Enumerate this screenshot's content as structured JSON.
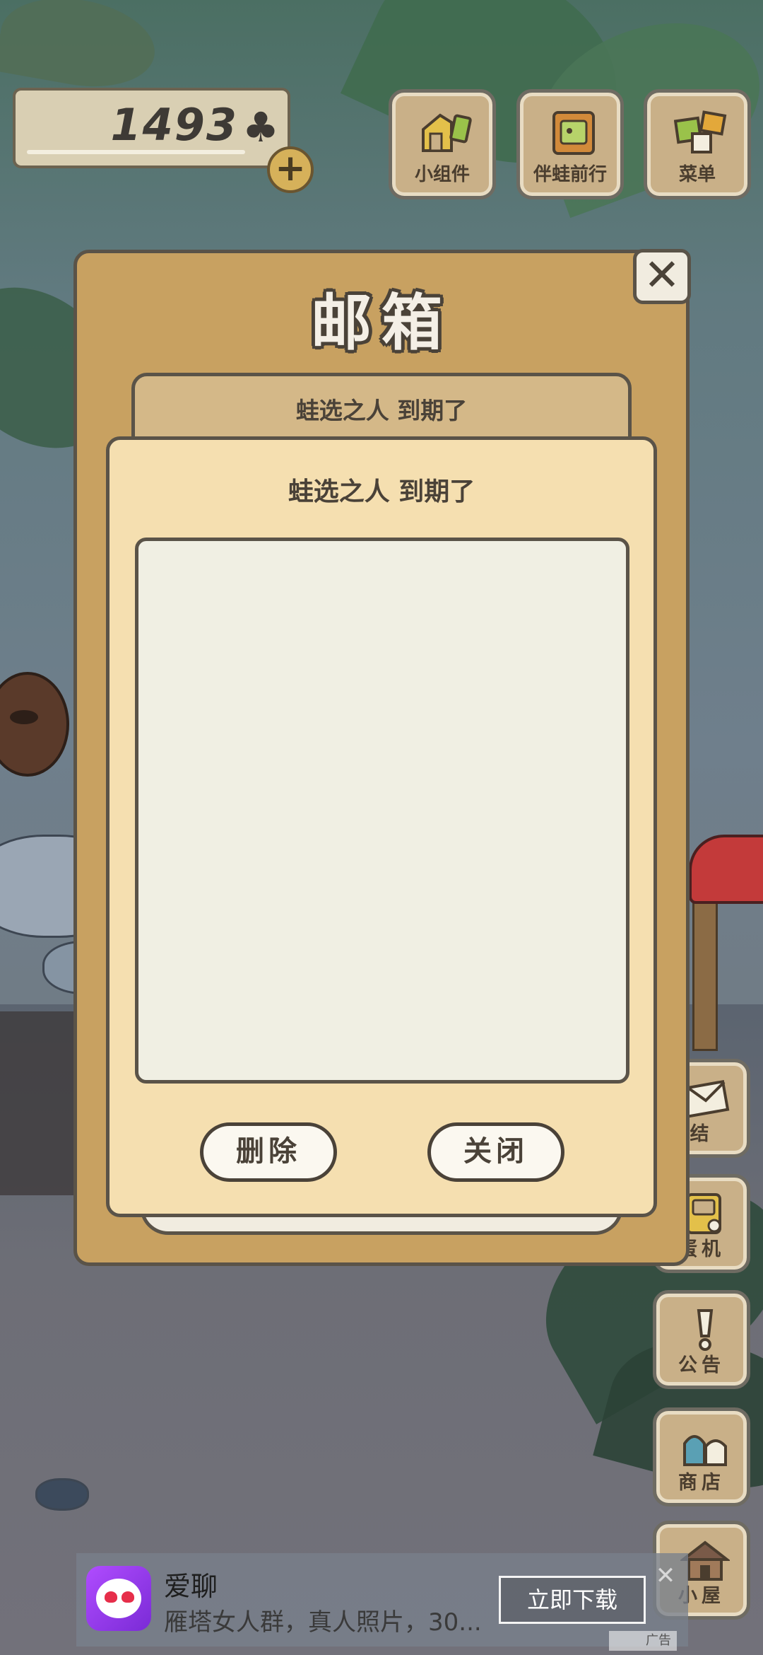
{
  "hud": {
    "clover_count": "1493",
    "clover_icon": "clover-icon",
    "add_icon": "plus-icon",
    "buttons": [
      {
        "label": "小组件",
        "icon": "widget-icon"
      },
      {
        "label": "伴蛙前行",
        "icon": "album-icon"
      },
      {
        "label": "菜单",
        "icon": "menu-icon"
      }
    ]
  },
  "side_buttons": [
    {
      "label": "结",
      "icon": "mail-icon"
    },
    {
      "label": "蛋机",
      "icon": "gacha-icon"
    },
    {
      "label": "公告",
      "icon": "exclamation-icon"
    },
    {
      "label": "商店",
      "icon": "shop-bag-icon"
    },
    {
      "label": "小屋",
      "icon": "house-icon"
    }
  ],
  "mailbox": {
    "title": "邮箱",
    "close_symbol": "✕",
    "tab_subject": "蛙选之人 到期了",
    "card_subject": "蛙选之人 到期了",
    "body": "",
    "delete_label": "删除",
    "close_label": "关闭"
  },
  "ad": {
    "app_name": "爱聊",
    "description": "雁塔女人群，真人照片，30...",
    "cta": "立即下载",
    "close_symbol": "✕",
    "tag": "广告"
  },
  "colors": {
    "dialog_bg": "#c8a161",
    "card_bg": "#f5dfb0",
    "body_bg": "#f0efe3",
    "outline": "#5a5348"
  }
}
